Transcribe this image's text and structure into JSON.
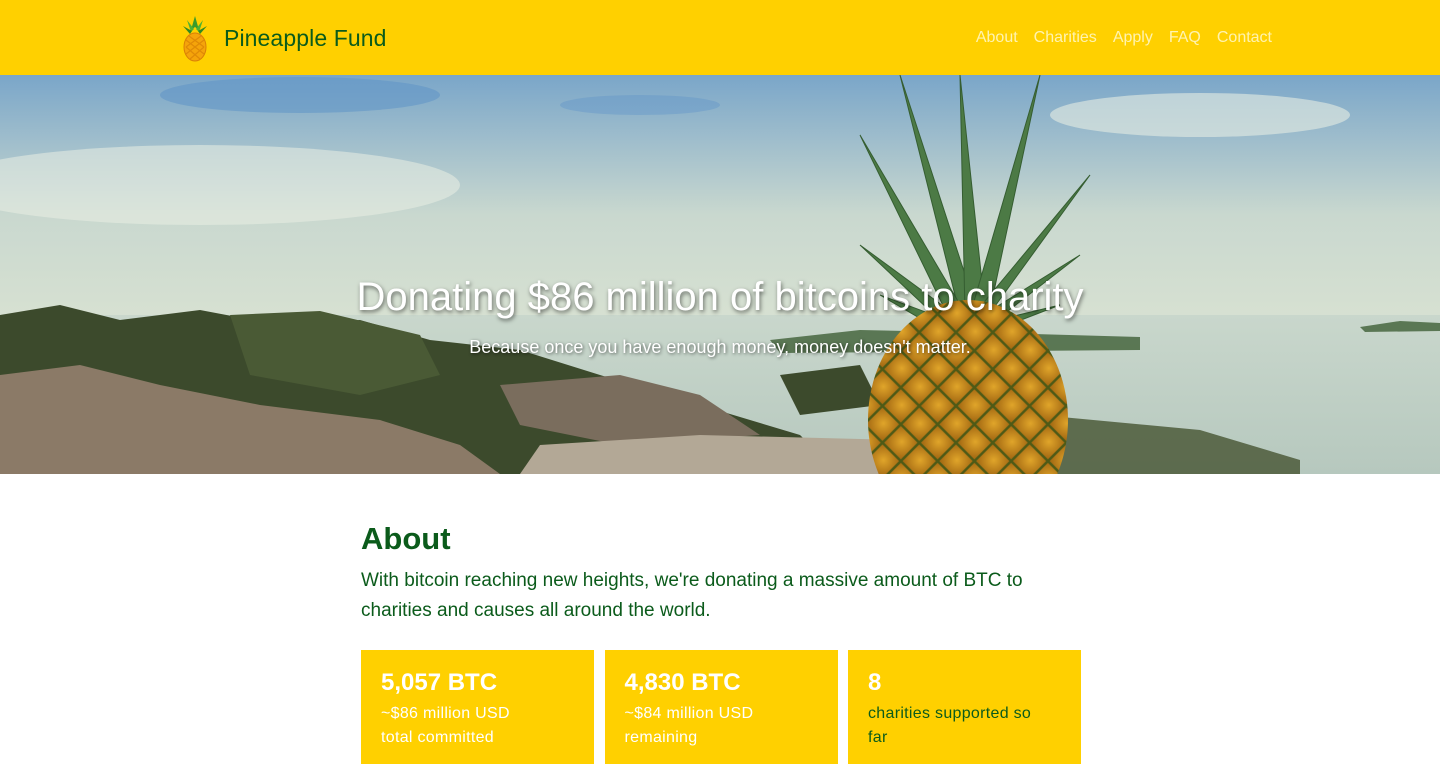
{
  "navbar": {
    "brand": "Pineapple Fund",
    "links": [
      "About",
      "Charities",
      "Apply",
      "FAQ",
      "Contact"
    ]
  },
  "hero": {
    "title": "Donating $86 million of bitcoins to charity",
    "subtitle": "Because once you have enough money, money doesn't matter."
  },
  "about": {
    "heading": "About",
    "text": "With bitcoin reaching new heights, we're donating a massive amount of BTC to charities and causes all around the world.",
    "stats": [
      {
        "value": "5,057 BTC",
        "line1": "~$86 million USD",
        "line2": "total committed"
      },
      {
        "value": "4,830 BTC",
        "line1": "~$84 million USD",
        "line2": "remaining"
      },
      {
        "value": "8",
        "line1": "charities supported so",
        "line2": "far"
      }
    ]
  },
  "colors": {
    "brand_yellow": "#ffd000",
    "brand_green": "#0b5b1b",
    "nav_link": "#fff3b0"
  }
}
